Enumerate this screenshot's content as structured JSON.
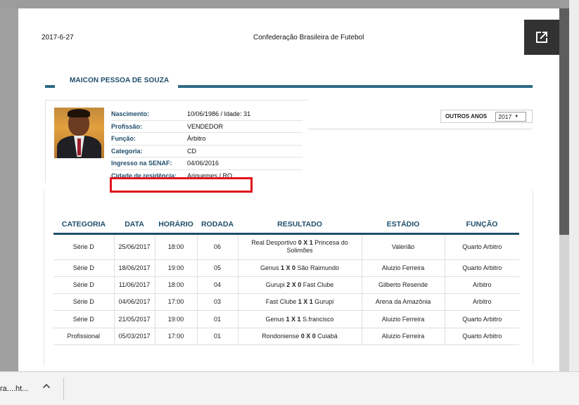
{
  "header": {
    "date": "2017-6-27",
    "org": "Confederação Brasileira de Futebol"
  },
  "profile": {
    "name": "MAICON PESSOA DE SOUZA",
    "rows": [
      {
        "label": "Nascimento:",
        "value": "10/06/1986 / Idade: 31"
      },
      {
        "label": "Profissão:",
        "value": "VENDEDOR"
      },
      {
        "label": "Função:",
        "value": "Árbitro"
      },
      {
        "label": "Categoria:",
        "value": "CD"
      },
      {
        "label": "Ingresso na SENAF:",
        "value": "04/06/2016"
      },
      {
        "label": "Cidade de residência:",
        "value": "Ariquemes / RO"
      }
    ]
  },
  "years": {
    "label": "OUTROS ANOS",
    "selected": "2017"
  },
  "table": {
    "headers": [
      "CATEGORIA",
      "DATA",
      "HORÁRIO",
      "RODADA",
      "RESULTADO",
      "ESTÁDIO",
      "FUNÇÃO"
    ],
    "rows": [
      {
        "categoria": "Série D",
        "data": "25/06/2017",
        "horario": "18:00",
        "rodada": "06",
        "home": "Real Desportivo",
        "score": "0 X 1",
        "away": "Princesa do Solimões",
        "estadio": "Valerião",
        "funcao": "Quarto Arbitro"
      },
      {
        "categoria": "Série D",
        "data": "18/06/2017",
        "horario": "19:00",
        "rodada": "05",
        "home": "Genus",
        "score": "1 X 0",
        "away": "São Raimundo",
        "estadio": "Aluizio Ferreira",
        "funcao": "Quarto Arbitro"
      },
      {
        "categoria": "Série D",
        "data": "11/06/2017",
        "horario": "18:00",
        "rodada": "04",
        "home": "Gurupi",
        "score": "2 X 0",
        "away": "Fast Clube",
        "estadio": "Gilberto Resende",
        "funcao": "Arbitro"
      },
      {
        "categoria": "Série D",
        "data": "04/06/2017",
        "horario": "17:00",
        "rodada": "03",
        "home": "Fast Clube",
        "score": "1 X 1",
        "away": "Gurupi",
        "estadio": "Arena da Amazônia",
        "funcao": "Arbitro"
      },
      {
        "categoria": "Série D",
        "data": "21/05/2017",
        "horario": "19:00",
        "rodada": "01",
        "home": "Genus",
        "score": "1 X 1",
        "away": "S.francisco",
        "estadio": "Aluizio Ferreira",
        "funcao": "Quarto Arbitro"
      },
      {
        "categoria": "Profissional",
        "data": "05/03/2017",
        "horario": "17:00",
        "rodada": "01",
        "home": "Rondoniense",
        "score": "0 X 0",
        "away": "Cuiabá",
        "estadio": "Aluizio Ferreira",
        "funcao": "Quarto Arbitro"
      }
    ]
  },
  "download": {
    "filename": "ra....ht..."
  },
  "icons": {
    "popout": "open-in-new-icon",
    "chevron": "chevron-up-icon"
  },
  "colors": {
    "accent": "#1f4e6b",
    "highlight": "#e1141e"
  }
}
